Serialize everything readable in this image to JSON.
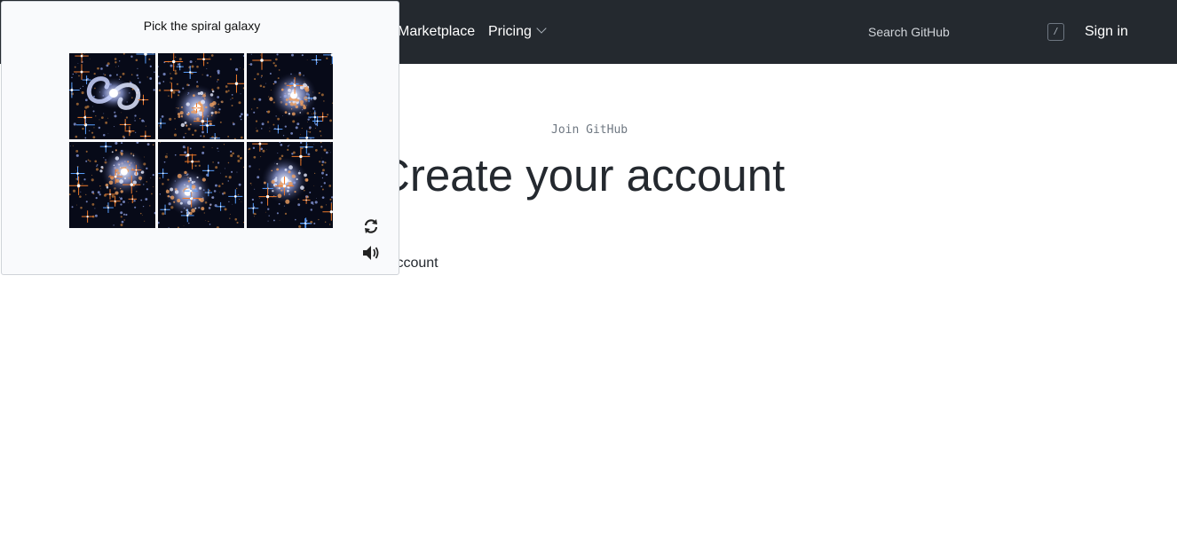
{
  "header": {
    "nav": [
      {
        "label": "Marketplace"
      },
      {
        "label": "Pricing"
      }
    ],
    "search": {
      "placeholder": "Search GitHub",
      "shortcut": "/"
    },
    "sign_in": "Sign in"
  },
  "main": {
    "join_label": "Join GitHub",
    "title": "Create your account",
    "subtitle": "our account"
  },
  "captcha": {
    "prompt": "Pick the spiral galaxy",
    "tiles": [
      "spiral-galaxy",
      "star-cluster",
      "star-cluster",
      "star-cluster",
      "star-cluster",
      "star-cluster"
    ],
    "refresh_icon": "refresh-icon",
    "audio_icon": "audio-icon"
  },
  "colors": {
    "header_bg": "#24292f",
    "captcha_bg": "#f9fafc",
    "star_orange": "#f07a2a",
    "star_blue": "#5aa0ff"
  }
}
